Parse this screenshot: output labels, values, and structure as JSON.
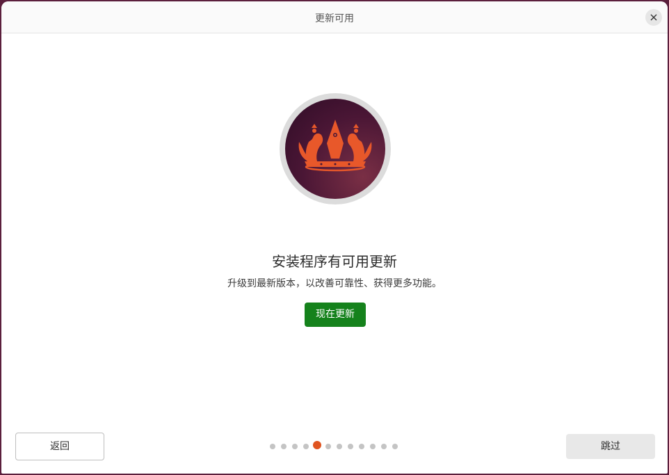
{
  "window": {
    "title": "更新可用"
  },
  "main": {
    "heading": "安装程序有可用更新",
    "description": "升级到最新版本，以改善可靠性、获得更多功能。",
    "update_button_label": "现在更新"
  },
  "footer": {
    "back_label": "返回",
    "skip_label": "跳过",
    "pagination": {
      "total": 12,
      "current": 5
    }
  },
  "colors": {
    "accent": "#e05420",
    "primary_button": "#15821c",
    "logo_background": "#4a1635"
  },
  "icons": {
    "close": "close-icon",
    "logo": "crown-logo-icon"
  }
}
